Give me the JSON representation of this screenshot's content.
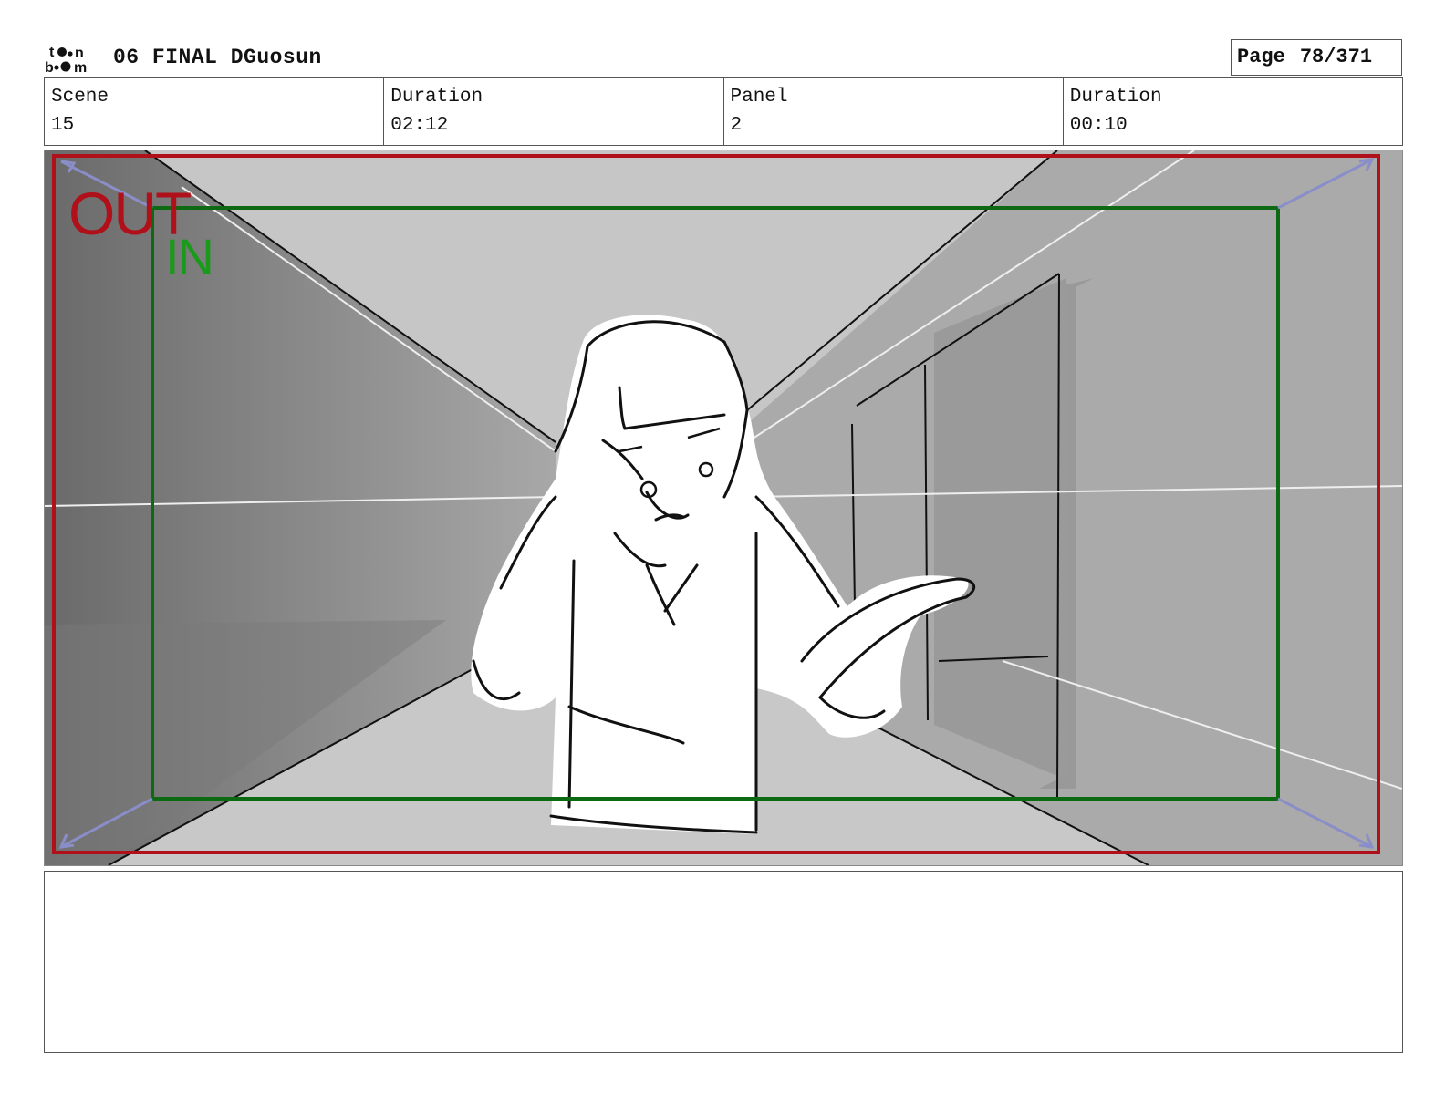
{
  "header": {
    "logo_text": "toon boom",
    "title": "06 FINAL DGuosun",
    "page_label": "Page",
    "page_value": "78/371"
  },
  "info": {
    "scene_label": "Scene",
    "scene_value": "15",
    "scene_duration_label": "Duration",
    "scene_duration_value": "02:12",
    "panel_label": "Panel",
    "panel_value": "2",
    "panel_duration_label": "Duration",
    "panel_duration_value": "00:10"
  },
  "panel": {
    "out_label": "OUT",
    "in_label": "IN",
    "out_color": "#b0101a",
    "in_color": "#1a9a1a",
    "in_frame_color": "#0d6a12",
    "arrow_color": "#8a8ec8"
  },
  "notes": {
    "text": ""
  }
}
